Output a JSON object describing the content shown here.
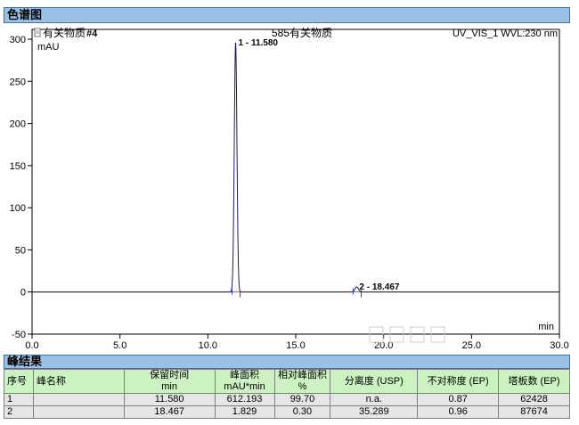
{
  "section_titles": {
    "chromatogram": "色谱图",
    "results": "峰结果"
  },
  "chart_header": {
    "sample": "有关物质",
    "sample_no": "#4",
    "title": "585有关物质",
    "channel": "UV_VIS_1 WVL:230 nm"
  },
  "chart_data": {
    "type": "line",
    "ylabel": "mAU",
    "xlabel": "min",
    "xlim": [
      0.0,
      30.0
    ],
    "ylim": [
      -50,
      300
    ],
    "xticks": [
      "0.0",
      "5.0",
      "10.0",
      "15.0",
      "20.0",
      "25.0",
      "30.0"
    ],
    "yticks": [
      "-50",
      "0",
      "50",
      "100",
      "150",
      "200",
      "250",
      "300"
    ],
    "line_color": "#1a1a5e",
    "peaks": [
      {
        "label": "1 - 11.580",
        "rt": 11.58,
        "height": 296
      },
      {
        "label": "2 - 18.467",
        "rt": 18.467,
        "height": 6
      }
    ]
  },
  "results": {
    "columns": [
      {
        "l1": "序号",
        "l2": ""
      },
      {
        "l1": "峰名称",
        "l2": ""
      },
      {
        "l1": "保留时间",
        "l2": "min"
      },
      {
        "l1": "峰面积",
        "l2": "mAU*min"
      },
      {
        "l1": "相对峰面积",
        "l2": "%"
      },
      {
        "l1": "分离度 (USP)",
        "l2": ""
      },
      {
        "l1": "不对称度 (EP)",
        "l2": ""
      },
      {
        "l1": "塔板数 (EP)",
        "l2": ""
      }
    ],
    "rows": [
      [
        "1",
        "",
        "11.580",
        "612.193",
        "99.70",
        "n.a.",
        "0.87",
        "62428"
      ],
      [
        "2",
        "",
        "18.467",
        "1.829",
        "0.30",
        "35.289",
        "0.96",
        "87674"
      ]
    ]
  }
}
